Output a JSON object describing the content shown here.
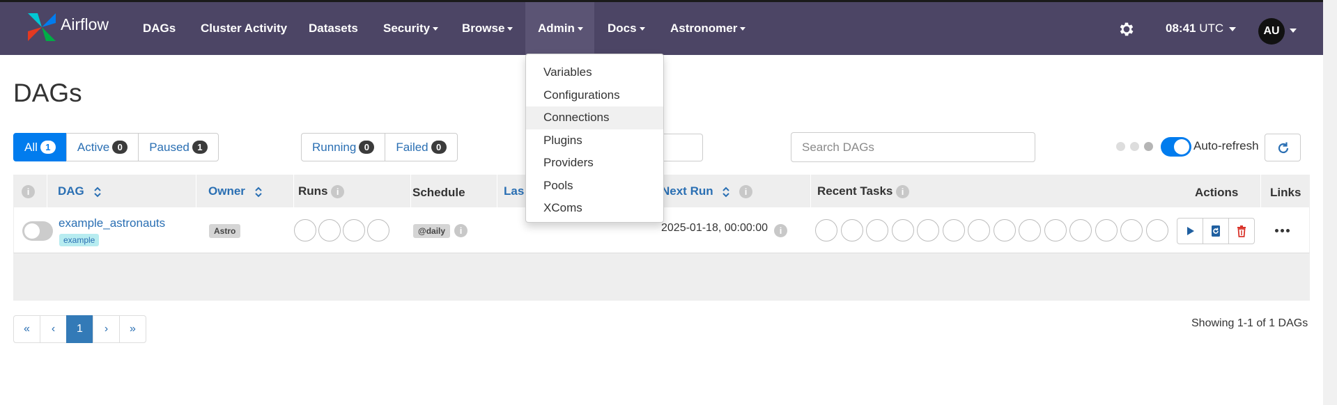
{
  "navbar": {
    "brand": "Airflow",
    "items": [
      {
        "label": "DAGs",
        "dropdown": false
      },
      {
        "label": "Cluster Activity",
        "dropdown": false
      },
      {
        "label": "Datasets",
        "dropdown": false
      },
      {
        "label": "Security",
        "dropdown": true
      },
      {
        "label": "Browse",
        "dropdown": true
      },
      {
        "label": "Admin",
        "dropdown": true,
        "active": true
      },
      {
        "label": "Docs",
        "dropdown": true
      },
      {
        "label": "Astronomer",
        "dropdown": true
      }
    ],
    "time": "08:41",
    "timezone": "UTC",
    "user_initials": "AU"
  },
  "admin_menu": {
    "items": [
      "Variables",
      "Configurations",
      "Connections",
      "Plugins",
      "Providers",
      "Pools",
      "XComs"
    ],
    "hovered": "Connections"
  },
  "page": {
    "title": "DAGs"
  },
  "filters": {
    "status": [
      {
        "label": "All",
        "count": "1",
        "active": true
      },
      {
        "label": "Active",
        "count": "0"
      },
      {
        "label": "Paused",
        "count": "1"
      }
    ],
    "runs": [
      {
        "label": "Running",
        "count": "0"
      },
      {
        "label": "Failed",
        "count": "0"
      }
    ],
    "search_placeholder": "Search DAGs",
    "auto_refresh_label": "Auto-refresh",
    "auto_refresh_on": true
  },
  "table": {
    "headers": {
      "dag": "DAG",
      "owner": "Owner",
      "runs": "Runs",
      "schedule": "Schedule",
      "last_run": "Las",
      "next_run": "Next Run",
      "recent_tasks": "Recent Tasks",
      "actions": "Actions",
      "links": "Links"
    },
    "rows": [
      {
        "dag_id": "example_astronauts",
        "tag": "example",
        "owner": "Astro",
        "schedule": "@daily",
        "next_run": "2025-01-18, 00:00:00",
        "paused": true
      }
    ]
  },
  "pagination": {
    "first": "«",
    "prev": "‹",
    "current": "1",
    "next": "›",
    "last": "»",
    "showing_text": "Showing 1-1 of 1 DAGs"
  },
  "colors": {
    "navbar": "#4c4565",
    "accent": "#017cee",
    "link": "#2a6fb3"
  }
}
